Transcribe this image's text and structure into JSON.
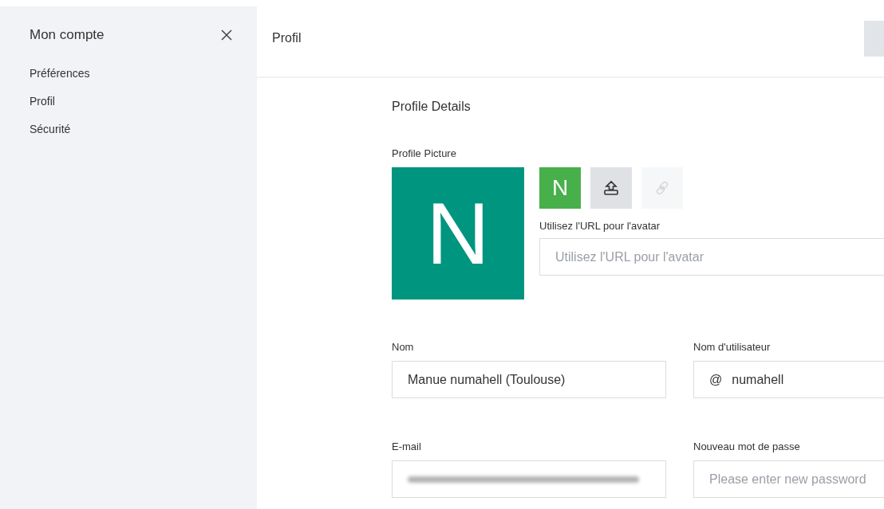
{
  "sidebar": {
    "title": "Mon compte",
    "items": [
      {
        "label": "Préférences",
        "selected": false
      },
      {
        "label": "Profil",
        "selected": false
      },
      {
        "label": "Sécurité",
        "selected": false
      }
    ]
  },
  "header": {
    "title": "Profil"
  },
  "section_title": "Profile Details",
  "picture": {
    "label": "Profile Picture",
    "initial": "N",
    "avatar_buttons": [
      {
        "kind": "initial",
        "text": "N",
        "disabled": false
      },
      {
        "kind": "upload",
        "disabled": false
      },
      {
        "kind": "link",
        "disabled": true
      }
    ],
    "url_label": "Utilisez l'URL pour l'avatar",
    "url_placeholder": "Utilisez l'URL pour l'avatar"
  },
  "fields": [
    {
      "label": "Nom",
      "value": "Manue numahell (Toulouse)",
      "kind": "text"
    },
    {
      "label": "Nom d'utilisateur",
      "prefix": "@",
      "value": "numahell",
      "kind": "prefixed"
    },
    {
      "label": "E-mail",
      "kind": "redacted"
    },
    {
      "label": "Nouveau mot de passe",
      "placeholder": "Please enter new password",
      "kind": "password"
    }
  ]
}
